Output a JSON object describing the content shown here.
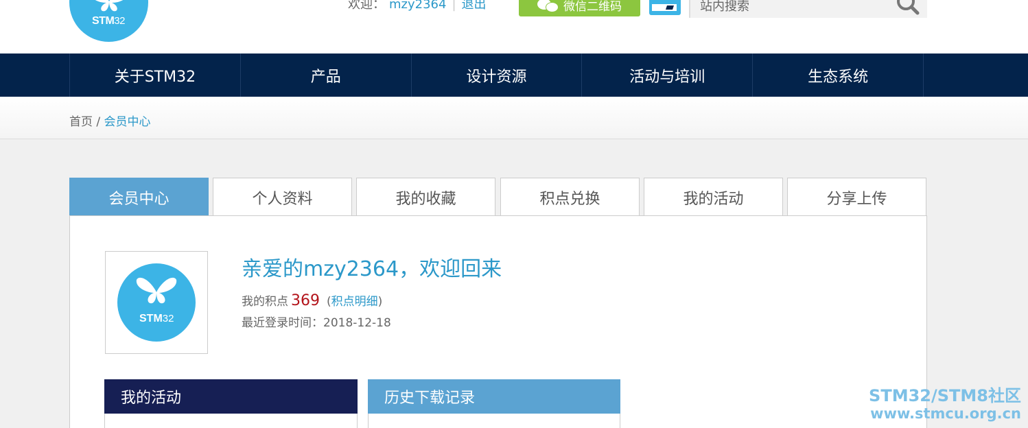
{
  "colors": {
    "brand": "#3cb4e6",
    "nav": "#03234b",
    "accent": "#2b98c9",
    "tab_active": "#5ba3d2",
    "wechat": "#8cc63f",
    "points": "#b3131a"
  },
  "header": {
    "logo_text_bold": "STM",
    "logo_text_num": "32",
    "welcome_label": "欢迎：",
    "username": "mzy2364",
    "separator": "|",
    "logout": "退出",
    "wechat_button": "微信二维码",
    "search_placeholder": "站内搜索"
  },
  "nav": {
    "items": [
      {
        "label": "关于STM32"
      },
      {
        "label": "产品"
      },
      {
        "label": "设计资源"
      },
      {
        "label": "活动与培训"
      },
      {
        "label": "生态系统"
      }
    ]
  },
  "breadcrumb": {
    "home": "首页",
    "sep": " / ",
    "current": "会员中心"
  },
  "tabs": [
    {
      "label": "会员中心"
    },
    {
      "label": "个人资料"
    },
    {
      "label": "我的收藏"
    },
    {
      "label": "积点兑换"
    },
    {
      "label": "我的活动"
    },
    {
      "label": "分享上传"
    }
  ],
  "profile": {
    "greeting": "亲爱的mzy2364，欢迎回来",
    "points_label": "我的积点",
    "points_value": "369",
    "detail_open": "(",
    "detail_link": "积点明细",
    "detail_close": ")",
    "last_login": "最近登录时间：2018-12-18"
  },
  "sections": {
    "my_activities": "我的活动",
    "download_history": "历史下载记录"
  },
  "watermark": {
    "line1": "STM32/STM8社区",
    "line2": "www.stmcu.org.cn"
  }
}
